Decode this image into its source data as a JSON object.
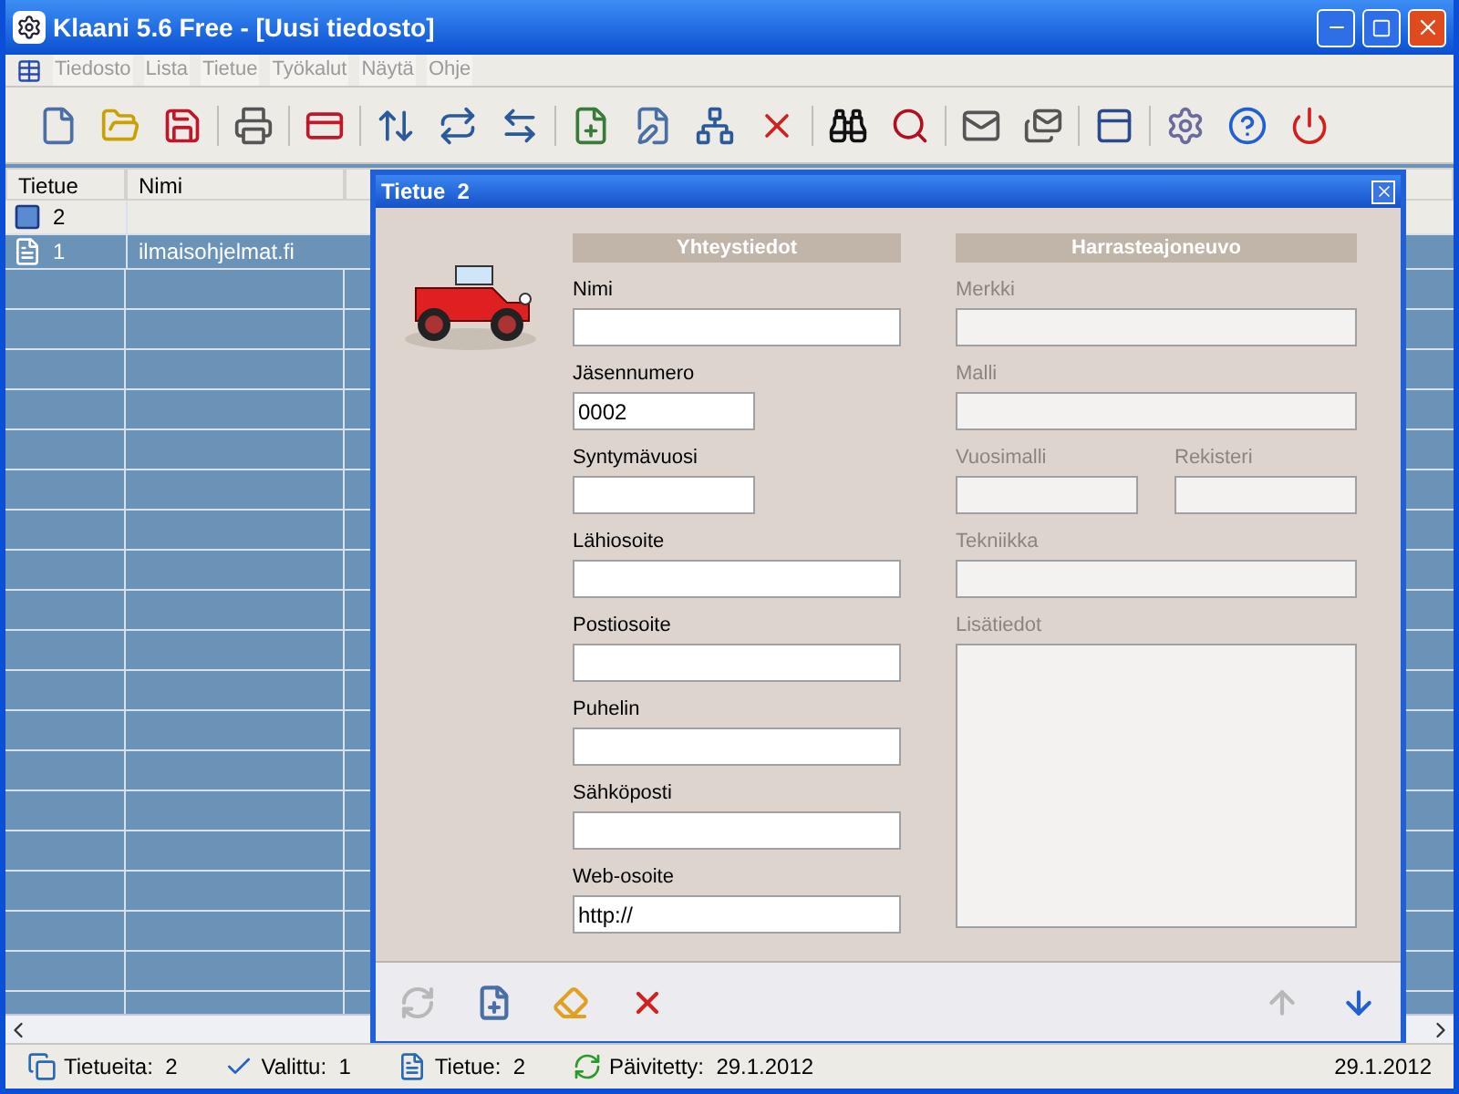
{
  "window": {
    "title": "Klaani 5.6 Free - [Uusi tiedosto]"
  },
  "menu": [
    {
      "label": "Tiedosto"
    },
    {
      "label": "Lista"
    },
    {
      "label": "Tietue"
    },
    {
      "label": "Työkalut"
    },
    {
      "label": "Näytä"
    },
    {
      "label": "Ohje"
    }
  ],
  "table": {
    "columns": [
      "Tietue",
      "Nimi"
    ],
    "rows": [
      {
        "cells": [
          "2",
          ""
        ],
        "selected": true
      },
      {
        "cells": [
          "1",
          "ilmaisohjelmat.fi"
        ],
        "selected": false
      }
    ]
  },
  "dialog": {
    "title": "Tietue  2",
    "left": {
      "heading": "Yhteystiedot",
      "fields": [
        {
          "label": "Nimi",
          "kind": "wide"
        },
        {
          "label": "Jäsennumero",
          "value": "0002",
          "kind": "narrow"
        },
        {
          "label": "Syntymävuosi",
          "kind": "narrow"
        },
        {
          "label": "Lähiosoite",
          "kind": "wide"
        },
        {
          "label": "Postiosoite",
          "kind": "wide"
        },
        {
          "label": "Puhelin",
          "kind": "wide"
        },
        {
          "label": "Sähköposti",
          "kind": "wide"
        },
        {
          "label": "Web-osoite",
          "value": "http://",
          "kind": "wide"
        }
      ]
    },
    "right": {
      "heading": "Harrasteajoneuvo",
      "rows": [
        [
          {
            "label": "Merkki",
            "disabled": true
          }
        ],
        [
          {
            "label": "Malli",
            "disabled": true
          }
        ],
        [
          {
            "label": "Vuosimalli",
            "disabled": true
          },
          {
            "label": "Rekisteri",
            "disabled": true
          }
        ],
        [
          {
            "label": "Tekniikka",
            "disabled": true
          }
        ]
      ],
      "notes": {
        "label": "Lisätiedot",
        "disabled": true
      }
    },
    "buttons": [
      {
        "kind": "refresh",
        "disabled": true
      },
      {
        "kind": "new",
        "disabled": false
      },
      {
        "kind": "erase",
        "disabled": false
      },
      {
        "kind": "delete",
        "disabled": false
      },
      {
        "kind": "up",
        "disabled": true
      },
      {
        "kind": "down",
        "disabled": false
      }
    ]
  },
  "status_bar": [
    {
      "kind": "count",
      "label": "Tietueita:  2"
    },
    {
      "kind": "selected",
      "label": "Valittu:  1"
    },
    {
      "kind": "record",
      "label": "Tietue:  2"
    },
    {
      "kind": "updated",
      "label": "Päivitetty:  29.1.2012"
    },
    {
      "kind": "date",
      "label": "29.1.2012"
    }
  ]
}
